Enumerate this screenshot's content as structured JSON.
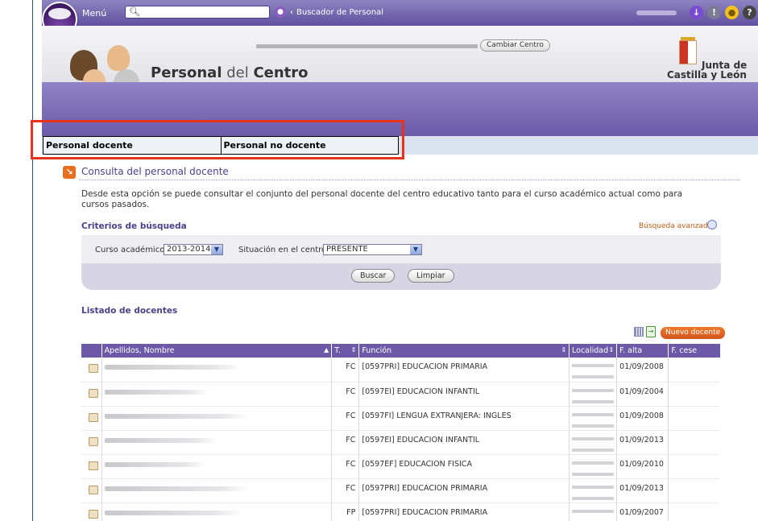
{
  "topbar": {
    "menu_label": "Menú",
    "breadcrumb_sep": "‹",
    "breadcrumb": "Buscador de Personal",
    "icons": [
      "download-icon",
      "info-icon",
      "tip-icon",
      "help-icon"
    ]
  },
  "header": {
    "title_bold1": "Personal",
    "title_thin": " del ",
    "title_bold2": "Centro",
    "change_centre_label": "Cambiar Centro",
    "logo_line1": "Junta de",
    "logo_line2": "Castilla y León"
  },
  "tabs": [
    {
      "label": "Personal docente"
    },
    {
      "label": "Personal no docente"
    }
  ],
  "section": {
    "title": "Consulta del personal docente",
    "description": "Desde esta opción se puede consultar el conjunto del personal docente del centro educativo tanto para el curso académico actual como para cursos pasados."
  },
  "criteria": {
    "title": "Criterios de búsqueda",
    "advanced_link": "Búsqueda avanzada",
    "year_label": "Curso académico:",
    "year_value": "2013-2014",
    "situation_label": "Situación en el centro:",
    "situation_value": "PRESENTE",
    "search_btn": "Buscar",
    "clear_btn": "Limpiar"
  },
  "listing": {
    "title": "Listado de docentes",
    "new_btn": "Nuevo docente",
    "columns": [
      "Apellidos, Nombre",
      "T.",
      "Función",
      "Localidad",
      "F. alta",
      "F. cese"
    ],
    "rows": [
      {
        "t": "FC",
        "funcion": "[0597PRI] EDUCACION PRIMARIA",
        "alta": "01/09/2008",
        "cese": ""
      },
      {
        "t": "FC",
        "funcion": "[0597EI] EDUCACION INFANTIL",
        "alta": "01/09/2004",
        "cese": ""
      },
      {
        "t": "FC",
        "funcion": "[0597FI] LENGUA EXTRANJERA: INGLES",
        "alta": "01/09/2008",
        "cese": ""
      },
      {
        "t": "FC",
        "funcion": "[0597EI] EDUCACION INFANTIL",
        "alta": "01/09/2013",
        "cese": ""
      },
      {
        "t": "FC",
        "funcion": "[0597EF] EDUCACION FISICA",
        "alta": "01/09/2010",
        "cese": ""
      },
      {
        "t": "FC",
        "funcion": "[0597PRI] EDUCACION PRIMARIA",
        "alta": "01/09/2013",
        "cese": ""
      },
      {
        "t": "FP",
        "funcion": "[0597PRI] EDUCACION PRIMARIA",
        "alta": "01/09/2007",
        "cese": ""
      }
    ]
  },
  "colors": {
    "accent": "#6c5aa8",
    "highlight": "#e8321e",
    "orange": "#e76f1f"
  }
}
